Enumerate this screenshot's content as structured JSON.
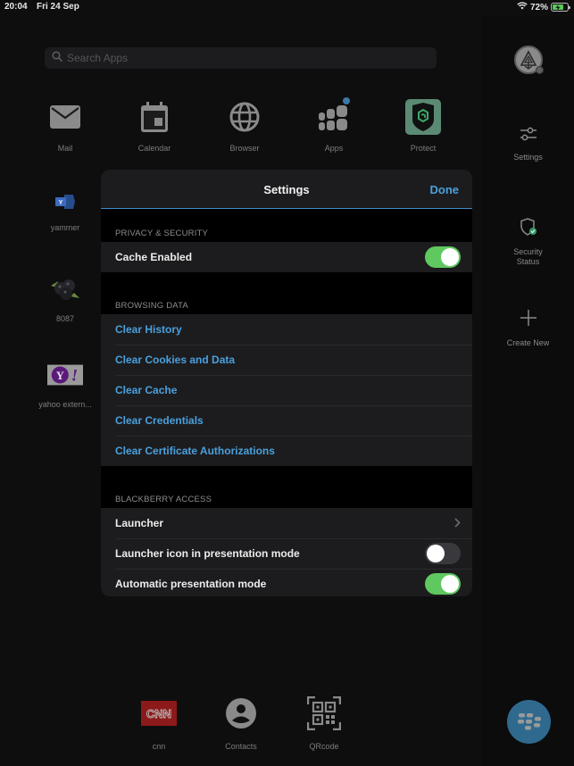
{
  "status_bar": {
    "time": "20:04",
    "date": "Fri 24 Sep",
    "battery_percent": "72%",
    "battery_level": 0.72,
    "wifi_icon": "wifi-icon",
    "charging": true
  },
  "search": {
    "placeholder": "Search Apps",
    "value": ""
  },
  "apps": [
    {
      "label": "Mail",
      "icon": "mail-icon"
    },
    {
      "label": "Calendar",
      "icon": "calendar-icon"
    },
    {
      "label": "Browser",
      "icon": "globe-icon"
    },
    {
      "label": "Apps",
      "icon": "apps-icon",
      "badge": true
    },
    {
      "label": "Protect",
      "icon": "protect-icon"
    },
    {
      "label": "yammer",
      "icon": "yammer-icon"
    },
    {
      "label": "8087",
      "icon": "blackberries-icon"
    },
    {
      "label": "yahoo extern...",
      "icon": "yahoo-icon"
    }
  ],
  "rail": {
    "avatar": "profile-avatar",
    "items": [
      {
        "label": "Settings",
        "icon": "sliders-icon"
      },
      {
        "label": "Security Status",
        "icon": "shield-check-icon"
      },
      {
        "label": "Create New",
        "icon": "plus-icon"
      }
    ]
  },
  "settings": {
    "title": "Settings",
    "done_label": "Done",
    "sections": [
      {
        "header": "PRIVACY & SECURITY",
        "rows": [
          {
            "label": "Cache Enabled",
            "type": "toggle",
            "on": true
          }
        ]
      },
      {
        "header": "BROWSING DATA",
        "rows": [
          {
            "label": "Clear History",
            "type": "link"
          },
          {
            "label": "Clear Cookies and Data",
            "type": "link"
          },
          {
            "label": "Clear Cache",
            "type": "link"
          },
          {
            "label": "Clear Credentials",
            "type": "link"
          },
          {
            "label": "Clear Certificate Authorizations",
            "type": "link"
          }
        ]
      },
      {
        "header": "BLACKBERRY ACCESS",
        "rows": [
          {
            "label": "Launcher",
            "type": "disclosure"
          },
          {
            "label": "Launcher icon in presentation mode",
            "type": "toggle",
            "on": false
          },
          {
            "label": "Automatic presentation mode",
            "type": "toggle",
            "on": true
          }
        ]
      }
    ]
  },
  "dock": [
    {
      "label": "cnn",
      "icon": "cnn-icon",
      "logo_text": "CNN"
    },
    {
      "label": "Contacts",
      "icon": "contacts-icon"
    },
    {
      "label": "QRcode",
      "icon": "qrcode-icon"
    }
  ],
  "colors": {
    "accent": "#4aa0dd",
    "toggle_on": "#5fc85f",
    "toggle_off": "#39393d",
    "panel_bg": "#1c1c1e",
    "background": "#0e0e0f",
    "fab": "#2f6a8e"
  }
}
